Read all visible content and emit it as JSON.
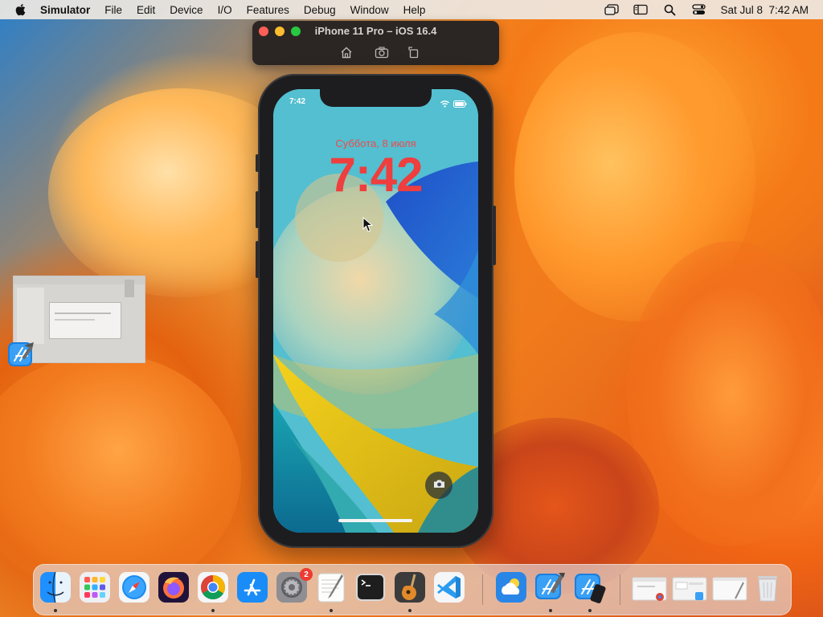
{
  "menubar": {
    "app_name": "Simulator",
    "items": [
      "File",
      "Edit",
      "Device",
      "I/O",
      "Features",
      "Debug",
      "Window",
      "Help"
    ],
    "clock": "Sat Jul 8  7:42 AM"
  },
  "simulator": {
    "title": "iPhone 11 Pro – iOS 16.4",
    "toolbar": [
      "home-icon",
      "screenshot-icon",
      "rotate-icon"
    ]
  },
  "lock_screen": {
    "status_time": "7:42",
    "date": "Суббота, 8 июля",
    "time": "7:42"
  },
  "dock": {
    "apps": [
      {
        "name": "Finder",
        "icon": "finder-icon",
        "running": true
      },
      {
        "name": "Launchpad",
        "icon": "launchpad-icon",
        "running": false
      },
      {
        "name": "Safari",
        "icon": "safari-icon",
        "running": false
      },
      {
        "name": "Firefox",
        "icon": "firefox-icon",
        "running": false
      },
      {
        "name": "Chrome",
        "icon": "chrome-icon",
        "running": true
      },
      {
        "name": "App Store",
        "icon": "app-store-icon",
        "running": false
      },
      {
        "name": "System Settings",
        "icon": "system-settings-icon",
        "running": false,
        "badge": "2"
      },
      {
        "name": "TextEdit",
        "icon": "textedit-icon",
        "running": true
      },
      {
        "name": "Terminal",
        "icon": "terminal-icon",
        "running": false
      },
      {
        "name": "GarageBand",
        "icon": "garageband-icon",
        "running": true
      },
      {
        "name": "Visual Studio Code",
        "icon": "vscode-icon",
        "running": false
      },
      {
        "name": "Weather",
        "icon": "weather-icon",
        "running": false
      },
      {
        "name": "Xcode",
        "icon": "xcode-icon",
        "running": true
      },
      {
        "name": "Simulator",
        "icon": "simulator-icon",
        "running": true
      }
    ]
  },
  "colors": {
    "lock_text": "#ee3e3e",
    "badge": "#ee3b30",
    "close": "#ff5f57",
    "minimize": "#febc2e",
    "zoom": "#28c840"
  }
}
